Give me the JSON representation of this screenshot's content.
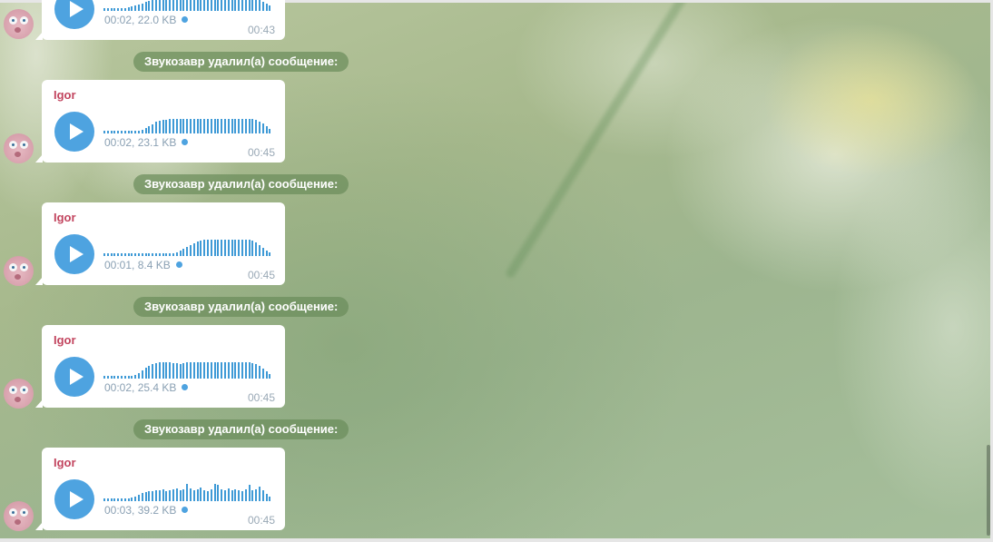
{
  "service_messages": [
    {
      "text": "Звукозавр удалил(а) сообщение:"
    },
    {
      "text": "Звукозавр удалил(а) сообщение:"
    },
    {
      "text": "Звукозавр удалил(а) сообщение:"
    },
    {
      "text": "Звукозавр удалил(а) сообщение:"
    }
  ],
  "messages": [
    {
      "sender": "",
      "duration_size": "00:02, 22.0 KB",
      "time": "00:43",
      "waveform": [
        3,
        3,
        3,
        3,
        3,
        3,
        3,
        4,
        5,
        6,
        7,
        8,
        10,
        11,
        12,
        12,
        13,
        13,
        14,
        14,
        14,
        14,
        14,
        14,
        14,
        14,
        14,
        14,
        14,
        14,
        14,
        14,
        14,
        14,
        14,
        14,
        14,
        14,
        14,
        14,
        14,
        14,
        14,
        14,
        13,
        12,
        10,
        8,
        6
      ]
    },
    {
      "sender": "Igor",
      "duration_size": "00:02, 23.1 KB",
      "time": "00:45",
      "waveform": [
        3,
        3,
        3,
        3,
        3,
        3,
        3,
        3,
        3,
        3,
        3,
        4,
        6,
        8,
        10,
        13,
        14,
        15,
        15,
        16,
        16,
        16,
        16,
        16,
        16,
        16,
        16,
        16,
        16,
        16,
        16,
        16,
        16,
        16,
        16,
        16,
        16,
        16,
        16,
        16,
        16,
        16,
        16,
        16,
        15,
        13,
        11,
        8,
        5
      ]
    },
    {
      "sender": "Igor",
      "duration_size": "00:01, 8.4 KB",
      "time": "00:45",
      "waveform": [
        3,
        3,
        3,
        3,
        3,
        3,
        3,
        3,
        3,
        3,
        3,
        3,
        3,
        3,
        3,
        3,
        3,
        3,
        3,
        3,
        3,
        4,
        6,
        8,
        10,
        12,
        14,
        16,
        17,
        18,
        18,
        18,
        18,
        18,
        18,
        18,
        18,
        18,
        18,
        18,
        18,
        18,
        18,
        17,
        15,
        12,
        9,
        6,
        4
      ]
    },
    {
      "sender": "Igor",
      "duration_size": "00:02, 25.4 KB",
      "time": "00:45",
      "waveform": [
        3,
        3,
        3,
        3,
        3,
        3,
        3,
        3,
        3,
        4,
        6,
        9,
        12,
        14,
        16,
        17,
        18,
        18,
        18,
        18,
        17,
        17,
        16,
        17,
        18,
        18,
        18,
        18,
        18,
        18,
        18,
        18,
        18,
        18,
        18,
        18,
        18,
        18,
        18,
        18,
        18,
        18,
        18,
        17,
        16,
        14,
        11,
        8,
        5
      ]
    },
    {
      "sender": "Igor",
      "duration_size": "00:03, 39.2 KB",
      "time": "00:45",
      "waveform": [
        3,
        3,
        3,
        3,
        3,
        3,
        3,
        3,
        4,
        5,
        7,
        9,
        10,
        11,
        11,
        12,
        12,
        13,
        11,
        12,
        13,
        14,
        12,
        13,
        19,
        14,
        12,
        13,
        15,
        12,
        11,
        13,
        19,
        18,
        13,
        12,
        14,
        12,
        13,
        12,
        11,
        13,
        18,
        12,
        13,
        16,
        12,
        8,
        5
      ]
    }
  ]
}
